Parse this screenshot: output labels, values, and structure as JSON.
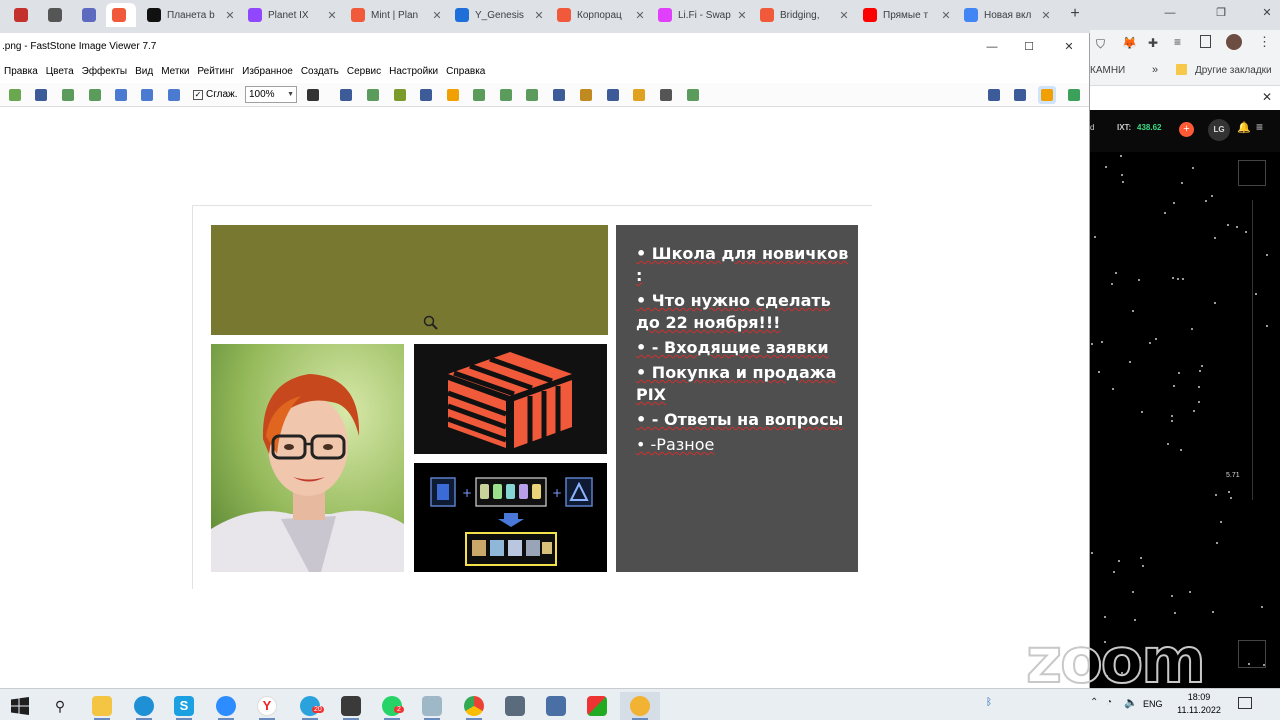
{
  "browser": {
    "tabs": [
      {
        "label": "",
        "icon": "youtube-live-icon",
        "active": false
      },
      {
        "label": "",
        "icon": "globe-icon",
        "active": false
      },
      {
        "label": "",
        "icon": "link-icon",
        "active": false
      },
      {
        "label": "",
        "icon": "planetix-icon",
        "active": true
      },
      {
        "label": "Планета b",
        "icon": "planetix-dark-icon",
        "active": false
      },
      {
        "label": "Planet IX",
        "icon": "twitch-icon",
        "active": false
      },
      {
        "label": "Mint | Plan",
        "icon": "planetix-icon",
        "active": false
      },
      {
        "label": "Y_Genesis",
        "icon": "blue-drop-icon",
        "active": false
      },
      {
        "label": "Корпорац",
        "icon": "planetix-icon",
        "active": false
      },
      {
        "label": "Li.Fi - Swap",
        "icon": "lifi-icon",
        "active": false
      },
      {
        "label": "Bridging,",
        "icon": "planetix-icon",
        "active": false
      },
      {
        "label": "Прямые т",
        "icon": "youtube-icon",
        "active": false
      },
      {
        "label": "Новая вкл",
        "icon": "chrome-icon",
        "active": false
      }
    ],
    "new_tab": "+",
    "bookmarks_partial": "КАМНИ",
    "bookmarks_more": "»",
    "other_bookmarks": "Другие закладки",
    "avatar_label": "LG",
    "ixt_label": "IXT:",
    "ixt_value": "438.62",
    "side_value": "5.71"
  },
  "viewer": {
    "title": ".png - FastStone Image Viewer 7.7",
    "menu": [
      "Правка",
      "Цвета",
      "Эффекты",
      "Вид",
      "Метки",
      "Рейтинг",
      "Избранное",
      "Создать",
      "Сервис",
      "Настройки",
      "Справка"
    ],
    "smooth_label": "Сглаж.",
    "smooth_checked": "✓",
    "zoom_value": "100%"
  },
  "slide": {
    "olive_color": "#787830",
    "bullets": [
      {
        "text": "• Школа для новичков :",
        "wave": "Школа для новичков"
      },
      {
        "text": "• Что нужно сделать до 22 ноября!!!",
        "wave": ""
      },
      {
        "text": "• - Входящие заявки",
        "wave": ""
      },
      {
        "text": "• Покупка и продажа PIX",
        "wave": ""
      },
      {
        "text": "• - Ответы на вопросы",
        "wave": ""
      },
      {
        "text": "• -Разное",
        "wave": ""
      }
    ]
  },
  "watermark": "zoom",
  "taskbar": {
    "lang": "ENG",
    "time": "18:09",
    "date": "11.11.2022",
    "telegram_badge": "20",
    "whatsapp_badge": "2"
  }
}
